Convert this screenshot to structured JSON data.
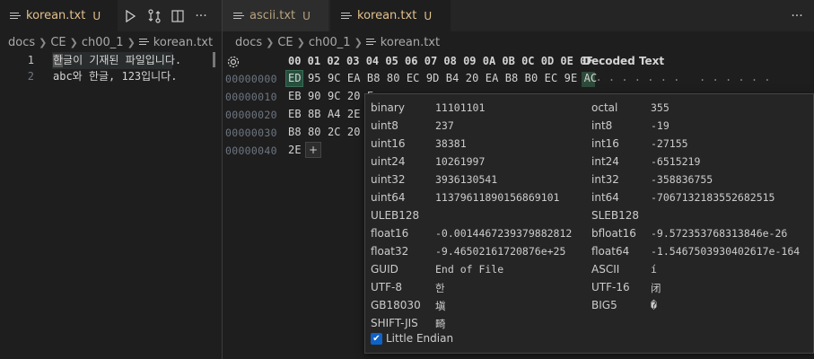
{
  "left": {
    "tab": {
      "label": "korean.txt",
      "status": "U"
    },
    "breadcrumb": [
      "docs",
      "CE",
      "ch00_1",
      "korean.txt"
    ],
    "lines": [
      {
        "num": "1",
        "text": "한글이 기재된 파일입니다."
      },
      {
        "num": "2",
        "text": "abc와 한글, 123입니다."
      }
    ],
    "actions": {
      "run": "run-icon",
      "compare": "compare-icon",
      "split": "split-editor-icon",
      "more": "···"
    }
  },
  "right": {
    "tabs": [
      {
        "label": "ascii.txt",
        "status": "U"
      },
      {
        "label": "korean.txt",
        "status": "U",
        "close": "×"
      }
    ],
    "more": "···",
    "breadcrumb": [
      "docs",
      "CE",
      "ch00_1",
      "korean.txt"
    ],
    "hex": {
      "header": "00 01 02 03 04 05 06 07 08 09 0A 0B 0C 0D 0E 0F",
      "decoded_label": "Decoded Text",
      "decoded_row0": ". . . . . . . .   . . . . . .",
      "offsets": [
        "00000000",
        "00000010",
        "00000020",
        "00000030",
        "00000040"
      ],
      "rows": [
        "ED 95 9C EA B8 80 EC 9D B4 20 EA B8 B0 EC 9E AC",
        "EB 90 9C 20 E",
        "EB 8B A4 2E 0",
        "B8 80 2C 20 3",
        "2E"
      ],
      "plus": "+"
    },
    "inspector": {
      "left": [
        {
          "k": "binary",
          "v": "11101101"
        },
        {
          "k": "uint8",
          "v": "237"
        },
        {
          "k": "uint16",
          "v": "38381"
        },
        {
          "k": "uint24",
          "v": "10261997"
        },
        {
          "k": "uint32",
          "v": "3936130541"
        },
        {
          "k": "uint64",
          "v": "11379611890156869101"
        },
        {
          "k": "ULEB128",
          "v": ""
        },
        {
          "k": "float16",
          "v": "-0.0014467239379882812"
        },
        {
          "k": "float32",
          "v": "-9.46502161720876e+25"
        },
        {
          "k": "GUID",
          "v": "End of File"
        },
        {
          "k": "UTF-8",
          "v": "한"
        },
        {
          "k": "GB18030",
          "v": "塡"
        },
        {
          "k": "SHIFT-JIS",
          "v": "畸"
        }
      ],
      "right": [
        {
          "k": "octal",
          "v": "355"
        },
        {
          "k": "int8",
          "v": "-19"
        },
        {
          "k": "int16",
          "v": "-27155"
        },
        {
          "k": "int24",
          "v": "-6515219"
        },
        {
          "k": "int32",
          "v": "-358836755"
        },
        {
          "k": "int64",
          "v": "-7067132183552682515"
        },
        {
          "k": "SLEB128",
          "v": ""
        },
        {
          "k": "bfloat16",
          "v": "-9.572353768313846e-26"
        },
        {
          "k": "float64",
          "v": "-1.5467503930402617e-164"
        },
        {
          "k": "ASCII",
          "v": "í"
        },
        {
          "k": "UTF-16",
          "v": "闭"
        },
        {
          "k": "BIG5",
          "v": "�"
        }
      ],
      "little_endian": "Little Endian",
      "check": "✔"
    }
  }
}
